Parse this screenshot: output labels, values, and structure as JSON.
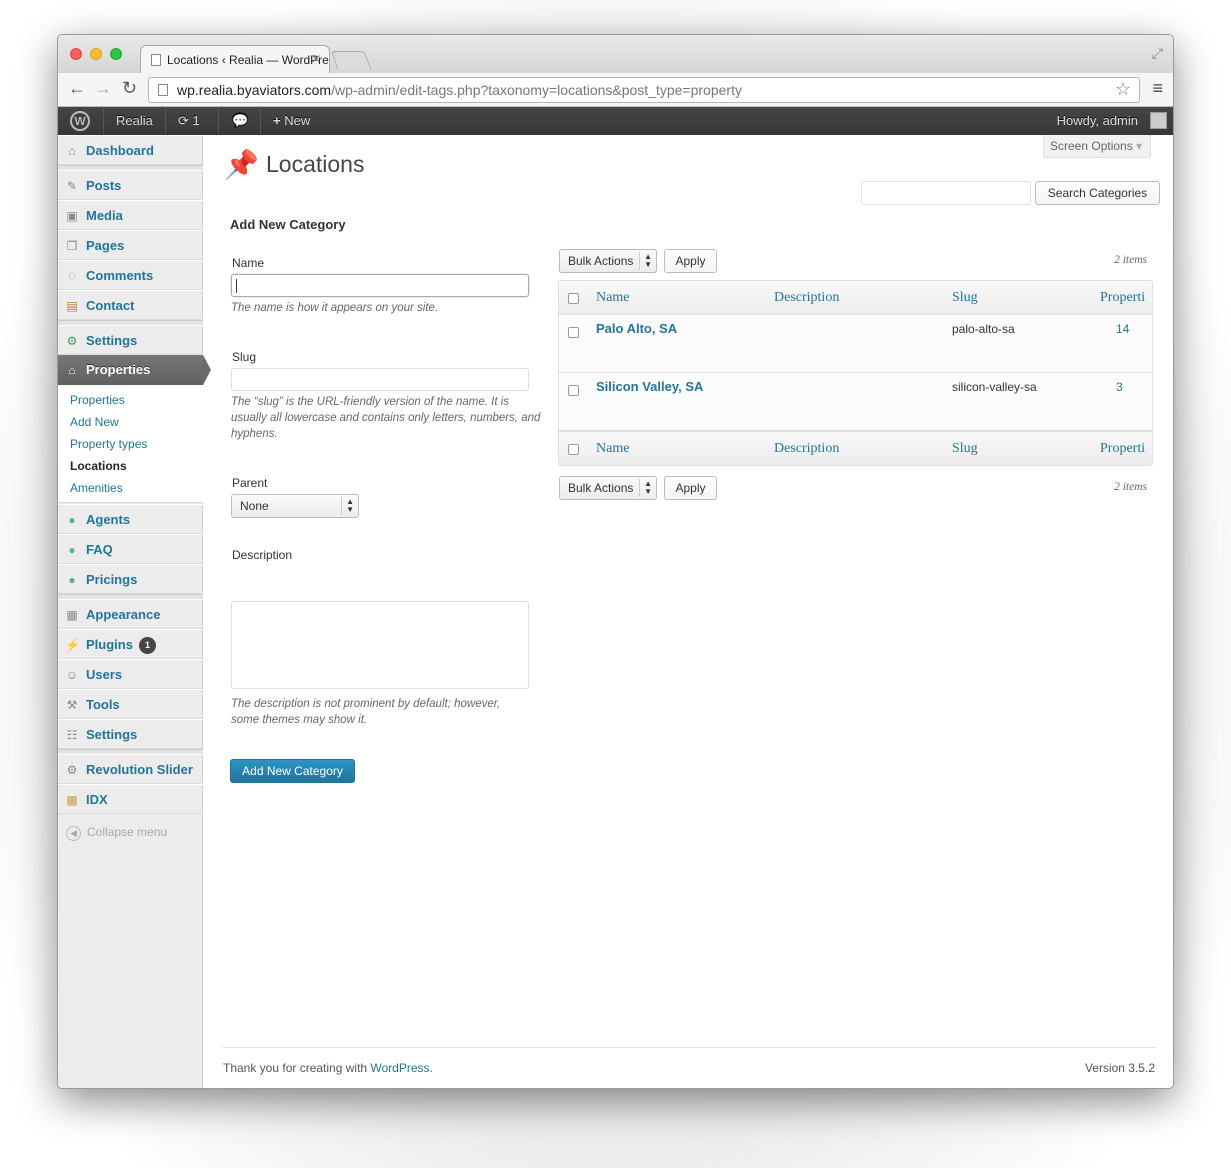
{
  "browser": {
    "tab_title": "Locations ‹ Realia — WordPress",
    "url_host": "wp.realia.byaviators.com",
    "url_path": "/wp-admin/edit-tags.php?taxonomy=locations&post_type=property"
  },
  "adminbar": {
    "site_name": "Realia",
    "updates_count": "1",
    "new_label": "New",
    "howdy": "Howdy, admin"
  },
  "sidebar": {
    "items": [
      {
        "label": "Dashboard",
        "icon": "dashboard-icon"
      },
      {
        "label": "Posts",
        "icon": "pin-icon"
      },
      {
        "label": "Media",
        "icon": "media-icon"
      },
      {
        "label": "Pages",
        "icon": "pages-icon"
      },
      {
        "label": "Comments",
        "icon": "comment-icon"
      },
      {
        "label": "Contact",
        "icon": "contact-icon"
      },
      {
        "label": "Settings",
        "icon": "settings-icon"
      },
      {
        "label": "Properties",
        "icon": "home-icon"
      },
      {
        "label": "Agents",
        "icon": "agents-icon"
      },
      {
        "label": "FAQ",
        "icon": "faq-icon"
      },
      {
        "label": "Pricings",
        "icon": "pricings-icon"
      },
      {
        "label": "Appearance",
        "icon": "appearance-icon"
      },
      {
        "label": "Plugins",
        "icon": "plugins-icon"
      },
      {
        "label": "Users",
        "icon": "users-icon"
      },
      {
        "label": "Tools",
        "icon": "tools-icon"
      },
      {
        "label": "Settings",
        "icon": "settings-icon"
      },
      {
        "label": "Revolution Slider",
        "icon": "gear-icon"
      },
      {
        "label": "IDX",
        "icon": "idx-icon"
      }
    ],
    "plugins_badge": "1",
    "submenu": [
      "Properties",
      "Add New",
      "Property types",
      "Locations",
      "Amenities"
    ],
    "collapse_label": "Collapse menu"
  },
  "main": {
    "screen_options": "Screen Options",
    "page_title": "Locations",
    "search_button": "Search Categories",
    "form": {
      "heading": "Add New Category",
      "name_label": "Name",
      "name_help": "The name is how it appears on your site.",
      "slug_label": "Slug",
      "slug_help": "The “slug” is the URL-friendly version of the name. It is usually all lowercase and contains only letters, numbers, and hyphens.",
      "parent_label": "Parent",
      "parent_value": "None",
      "description_label": "Description",
      "description_help": "The description is not prominent by default; however, some themes may show it.",
      "submit_label": "Add New Category"
    },
    "bulk_actions": "Bulk Actions",
    "apply": "Apply",
    "items_count": "2 items",
    "columns": [
      "Name",
      "Description",
      "Slug",
      "Properti"
    ],
    "rows": [
      {
        "name": "Palo Alto, SA",
        "description": "",
        "slug": "palo-alto-sa",
        "count": "14"
      },
      {
        "name": "Silicon Valley, SA",
        "description": "",
        "slug": "silicon-valley-sa",
        "count": "3"
      }
    ]
  },
  "footer": {
    "thanks_prefix": "Thank you for creating with ",
    "wp_link": "WordPress",
    "thanks_suffix": ".",
    "version": "Version 3.5.2"
  }
}
